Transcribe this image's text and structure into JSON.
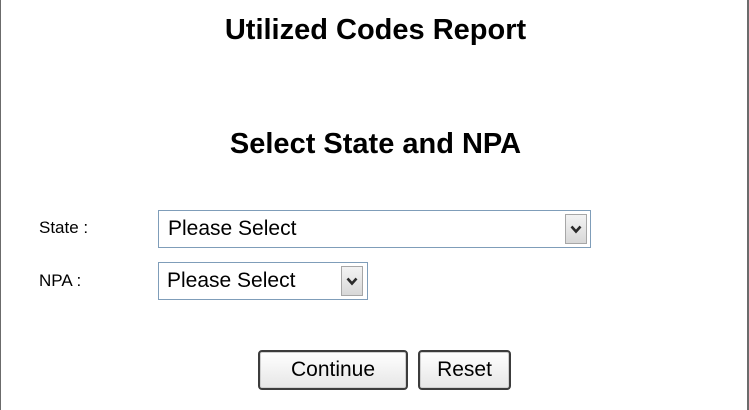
{
  "page": {
    "title": "Utilized Codes Report",
    "subtitle": "Select State and NPA"
  },
  "form": {
    "state_label": "State :",
    "state_value": "Please Select",
    "npa_label": "NPA :",
    "npa_value": "Please Select",
    "dropdown_icon": "chevron-down-icon"
  },
  "buttons": {
    "continue_label": "Continue",
    "reset_label": "Reset"
  },
  "colors": {
    "select_border": "#7f9db9",
    "frame_border": "#6b6b6b",
    "button_border": "#3c3c3c"
  }
}
